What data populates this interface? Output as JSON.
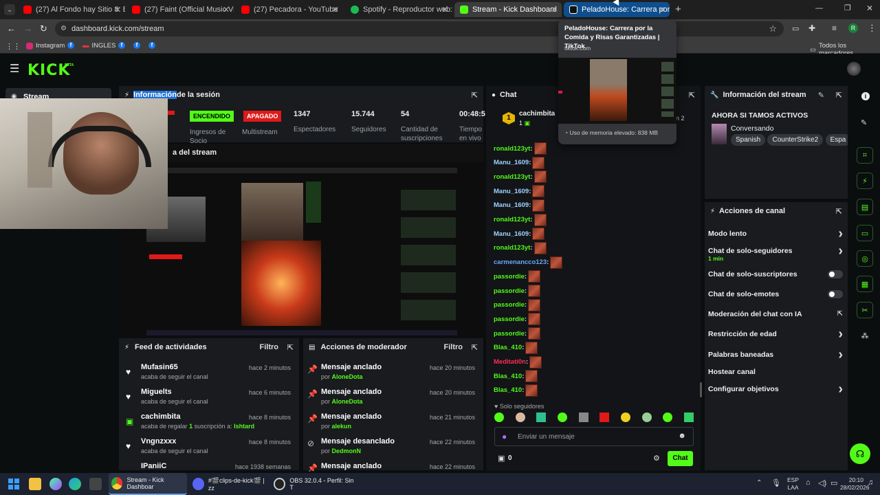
{
  "tabs": [
    {
      "label": "(27) Al Fondo hay Sitio 8: Belén",
      "icon": "youtube-icon"
    },
    {
      "label": "(27) Faint (Official Music Video)",
      "icon": "youtube-icon"
    },
    {
      "label": "(27) Pecadora - YouTube",
      "icon": "youtube-icon"
    },
    {
      "label": "Spotify - Reproductor web: mú",
      "icon": "spotify-icon"
    },
    {
      "label": "Stream - Kick Dashboard",
      "icon": "kick-icon"
    },
    {
      "label": "PeladoHouse: Carrera por la Co",
      "icon": "tiktok-icon"
    }
  ],
  "address": {
    "url": "dashboard.kick.com/stream"
  },
  "bookmarks": {
    "instagram": "Instagram",
    "ingles": "INGLES",
    "all": "Todos los marcadores"
  },
  "tooltip": {
    "title": "PeladoHouse: Carrera por la Comida y Risas Garantizadas | TikTok",
    "domain": "tiktok.com",
    "memory": "Uso de memoria elevado: 838 MB"
  },
  "kick": {
    "logo": "KICK",
    "beta": "BETA"
  },
  "sidebar": {
    "stream": "Stream"
  },
  "session": {
    "title_highlight": "Información",
    "title_rest": " de la sesión",
    "badge_on": "ENCENDIDO",
    "badge_off": "APAGADO",
    "stats": [
      {
        "value": "1347",
        "label": "Espectadores"
      },
      {
        "value": "15.744",
        "label": "Seguidores"
      },
      {
        "value": "54",
        "label": "Cantidad de suscripciones"
      },
      {
        "value": "00:48:5",
        "label": "Tiempo en vivo"
      }
    ],
    "ingresos": "Ingresos de Socio",
    "multistream": "Multistream"
  },
  "preview": {
    "title": "a del stream"
  },
  "feed": {
    "title": "Feed de actividades",
    "filter": "Filtro",
    "items": [
      {
        "name": "Mufasin65",
        "sub": "acaba de seguir el canal",
        "time": "hace 2 minutos"
      },
      {
        "name": "Miguelts",
        "sub": "acaba de seguir el canal",
        "time": "hace 6 minutos"
      },
      {
        "name": "cachimbita",
        "sub_pre": "acaba de regalar ",
        "sub_num": "1",
        "sub_mid": " suscripción a: ",
        "sub_user": "Ishtard",
        "time": "hace 8 minutos"
      },
      {
        "name": "Vngnzxxx",
        "sub": "acaba de seguir el canal",
        "time": "hace 8 minutos"
      },
      {
        "name": "IPaniiC",
        "sub": "",
        "time": "hace 1938 semanas"
      }
    ]
  },
  "mod": {
    "title": "Acciones de moderador",
    "filter": "Filtro",
    "items": [
      {
        "action": "Mensaje anclado",
        "by": "por ",
        "user": "AloneDota",
        "time": "hace 20 minutos"
      },
      {
        "action": "Mensaje anclado",
        "by": "por ",
        "user": "AloneDota",
        "time": "hace 20 minutos"
      },
      {
        "action": "Mensaje anclado",
        "by": "por ",
        "user": "alekun",
        "time": "hace 21 minutos"
      },
      {
        "action": "Mensaje desanclado",
        "by": "por ",
        "user": "DedmonN",
        "time": "hace 22 minutos"
      },
      {
        "action": "Mensaje anclado",
        "by": "",
        "user": "",
        "time": "hace 22 minutos"
      }
    ]
  },
  "chat": {
    "title": "Chat",
    "pinned_user": "cachimbita",
    "pinned_count": "1",
    "pinned_extra": "n 2",
    "messages": [
      {
        "user": "ronald123yt",
        "color": "#53fc18"
      },
      {
        "user": "Manu_1609",
        "color": "#9fd3ff"
      },
      {
        "user": "ronald123yt",
        "color": "#53fc18"
      },
      {
        "user": "Manu_1609",
        "color": "#9fd3ff"
      },
      {
        "user": "Manu_1609",
        "color": "#9fd3ff"
      },
      {
        "user": "ronald123yt",
        "color": "#53fc18"
      },
      {
        "user": "Manu_1609",
        "color": "#9fd3ff"
      },
      {
        "user": "ronald123yt",
        "color": "#53fc18"
      },
      {
        "user": "carmenancco123",
        "color": "#6aa8ff"
      },
      {
        "user": "passordie",
        "color": "#53fc18"
      },
      {
        "user": "passordie",
        "color": "#53fc18"
      },
      {
        "user": "passordie",
        "color": "#53fc18"
      },
      {
        "user": "passordie",
        "color": "#53fc18"
      },
      {
        "user": "passordie",
        "color": "#53fc18"
      },
      {
        "user": "Blas_410",
        "color": "#53fc18"
      },
      {
        "user": "Meditati0n",
        "color": "#ff2d55"
      },
      {
        "user": "Blas_410",
        "color": "#53fc18"
      },
      {
        "user": "Blas_410",
        "color": "#53fc18"
      }
    ],
    "followers_only": "Solo seguidores",
    "input_placeholder": "Enviar un mensaje",
    "points": "0",
    "send": "Chat"
  },
  "info": {
    "title": "Información del stream",
    "stream_title": "AHORA SI TAMOS ACTIVOS",
    "category": "Conversando",
    "tags": [
      "Spanish",
      "CounterStrike2",
      "Espa"
    ]
  },
  "actions": {
    "title": "Acciones de canal",
    "items": [
      {
        "label": "Modo lento",
        "type": "arrow"
      },
      {
        "label": "Chat de solo-seguidores",
        "sub": "1 min",
        "type": "arrow"
      },
      {
        "label": "Chat de solo-suscriptores",
        "type": "toggle"
      },
      {
        "label": "Chat de solo-emotes",
        "type": "toggle"
      },
      {
        "label": "Moderación del chat con IA",
        "type": "external"
      },
      {
        "label": "Restricción de edad",
        "type": "arrow"
      },
      {
        "label": "Palabras baneadas",
        "type": "arrow"
      },
      {
        "label": "Hostear canal",
        "type": "none"
      },
      {
        "label": "Configurar objetivos",
        "type": "arrow"
      }
    ]
  },
  "taskbar": {
    "chrome": "Stream - Kick Dashboar",
    "discord": "#🎬clips-de-kick🎬 | zz",
    "obs": "OBS 32.0.4 - Perfil: Sin T",
    "lang1": "ESP",
    "lang2": "LAA",
    "time": "20:10",
    "date": "28/02/2026"
  }
}
